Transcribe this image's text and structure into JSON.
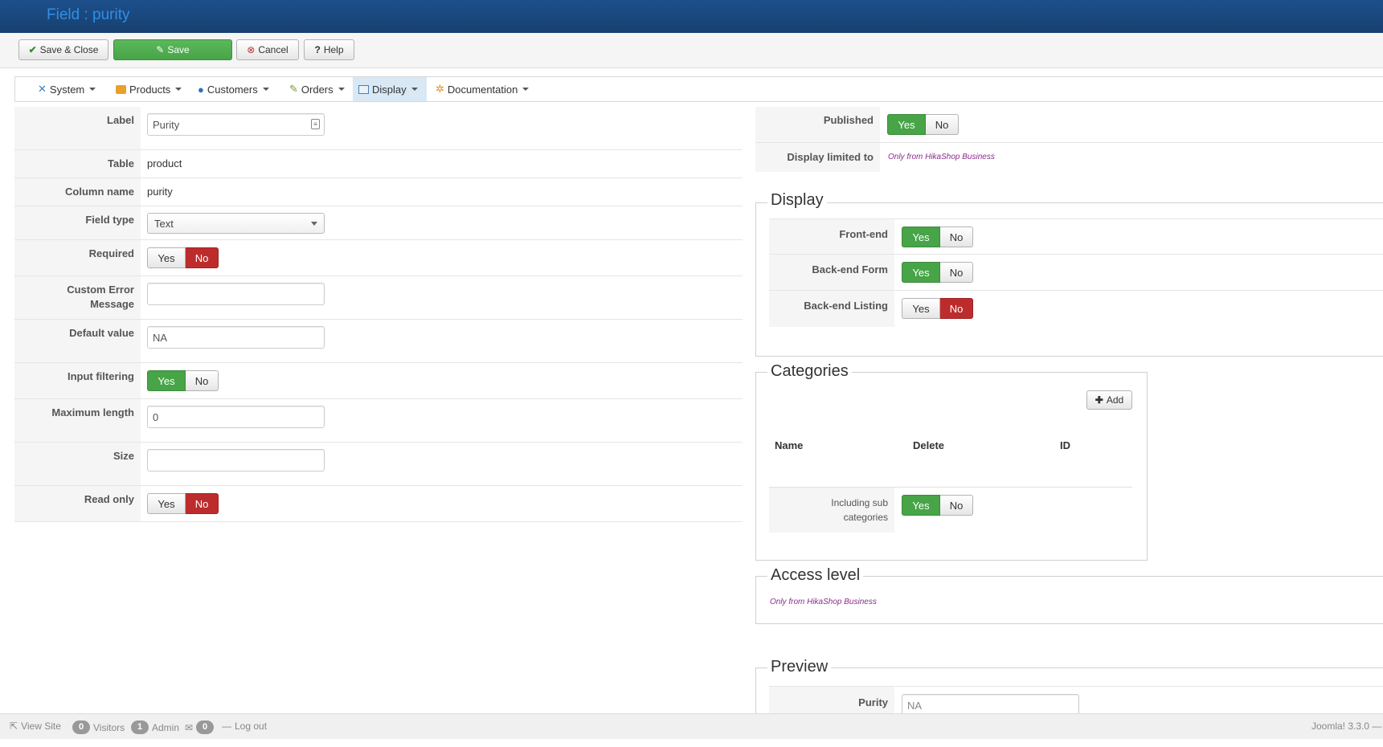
{
  "header": {
    "title": "Field : purity"
  },
  "toolbar": {
    "save_close": "Save & Close",
    "save": "Save",
    "cancel": "Cancel",
    "help": "Help"
  },
  "menu": {
    "items": [
      {
        "label": "System",
        "icon": "tools-icon"
      },
      {
        "label": "Products",
        "icon": "box-icon"
      },
      {
        "label": "Customers",
        "icon": "users-icon"
      },
      {
        "label": "Orders",
        "icon": "orders-icon"
      },
      {
        "label": "Display",
        "icon": "display-icon",
        "active": true
      },
      {
        "label": "Documentation",
        "icon": "documentation-icon"
      }
    ]
  },
  "form": {
    "label": {
      "key": "Label",
      "value": "Purity"
    },
    "table": {
      "key": "Table",
      "value": "product"
    },
    "column_name": {
      "key": "Column name",
      "value": "purity"
    },
    "field_type": {
      "key": "Field type",
      "value": "Text"
    },
    "required": {
      "key": "Required",
      "yes": "Yes",
      "no": "No",
      "selected": "No"
    },
    "custom_error": {
      "key_line1": "Custom Error",
      "key_line2": "Message",
      "value": ""
    },
    "default_value": {
      "key": "Default value",
      "value": "NA"
    },
    "input_filtering": {
      "key": "Input filtering",
      "yes": "Yes",
      "no": "No",
      "selected": "Yes"
    },
    "max_length": {
      "key": "Maximum length",
      "value": "0"
    },
    "size": {
      "key": "Size",
      "value": ""
    },
    "read_only": {
      "key": "Read only",
      "yes": "Yes",
      "no": "No",
      "selected": "No"
    }
  },
  "right": {
    "published": {
      "key": "Published",
      "yes": "Yes",
      "no": "No",
      "selected": "Yes"
    },
    "display_limited": {
      "key": "Display limited to",
      "note": "Only from HikaShop Business"
    },
    "display": {
      "legend": "Display",
      "frontend": {
        "key": "Front-end",
        "yes": "Yes",
        "no": "No",
        "selected": "Yes"
      },
      "backend_form": {
        "key": "Back-end Form",
        "yes": "Yes",
        "no": "No",
        "selected": "Yes"
      },
      "backend_listing": {
        "key": "Back-end Listing",
        "yes": "Yes",
        "no": "No",
        "selected": "No"
      }
    },
    "categories": {
      "legend": "Categories",
      "add": "Add",
      "col_name": "Name",
      "col_delete": "Delete",
      "col_id": "ID",
      "including_line1": "Including sub",
      "including_line2": "categories",
      "yes": "Yes",
      "no": "No",
      "selected": "Yes"
    },
    "access": {
      "legend": "Access level",
      "note": "Only from HikaShop Business"
    },
    "preview": {
      "legend": "Preview",
      "key": "Purity",
      "value": "NA"
    }
  },
  "footer": {
    "view_site": "View Site",
    "visitors_count": "0",
    "visitors": "Visitors",
    "admin_count": "1",
    "admin": "Admin",
    "messages_count": "0",
    "logout": "Log out",
    "version": "Joomla! 3.3.0 —"
  }
}
